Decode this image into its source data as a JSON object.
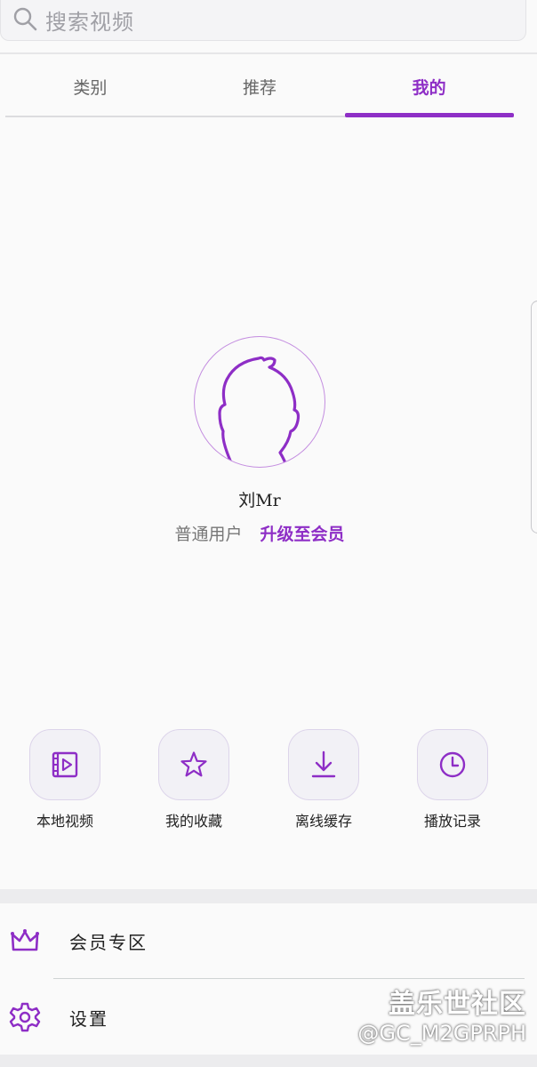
{
  "search": {
    "placeholder": "搜索视频"
  },
  "tabs": [
    {
      "label": "类别",
      "active": false
    },
    {
      "label": "推荐",
      "active": false
    },
    {
      "label": "我的",
      "active": true
    }
  ],
  "profile": {
    "username": "刘Mr",
    "level": "普通用户",
    "upgrade_label": "升级至会员"
  },
  "quick_actions": [
    {
      "label": "本地视频",
      "icon": "local-video-icon"
    },
    {
      "label": "我的收藏",
      "icon": "star-icon"
    },
    {
      "label": "离线缓存",
      "icon": "download-icon"
    },
    {
      "label": "播放记录",
      "icon": "clock-icon"
    }
  ],
  "menu": [
    {
      "label": "会员专区",
      "icon": "crown-icon"
    },
    {
      "label": "设置",
      "icon": "gear-icon"
    }
  ],
  "watermark": {
    "title": "盖乐世社区",
    "handle": "@GC_M2GPRPH"
  },
  "colors": {
    "accent": "#8e2ec6",
    "background": "#fafafa"
  }
}
